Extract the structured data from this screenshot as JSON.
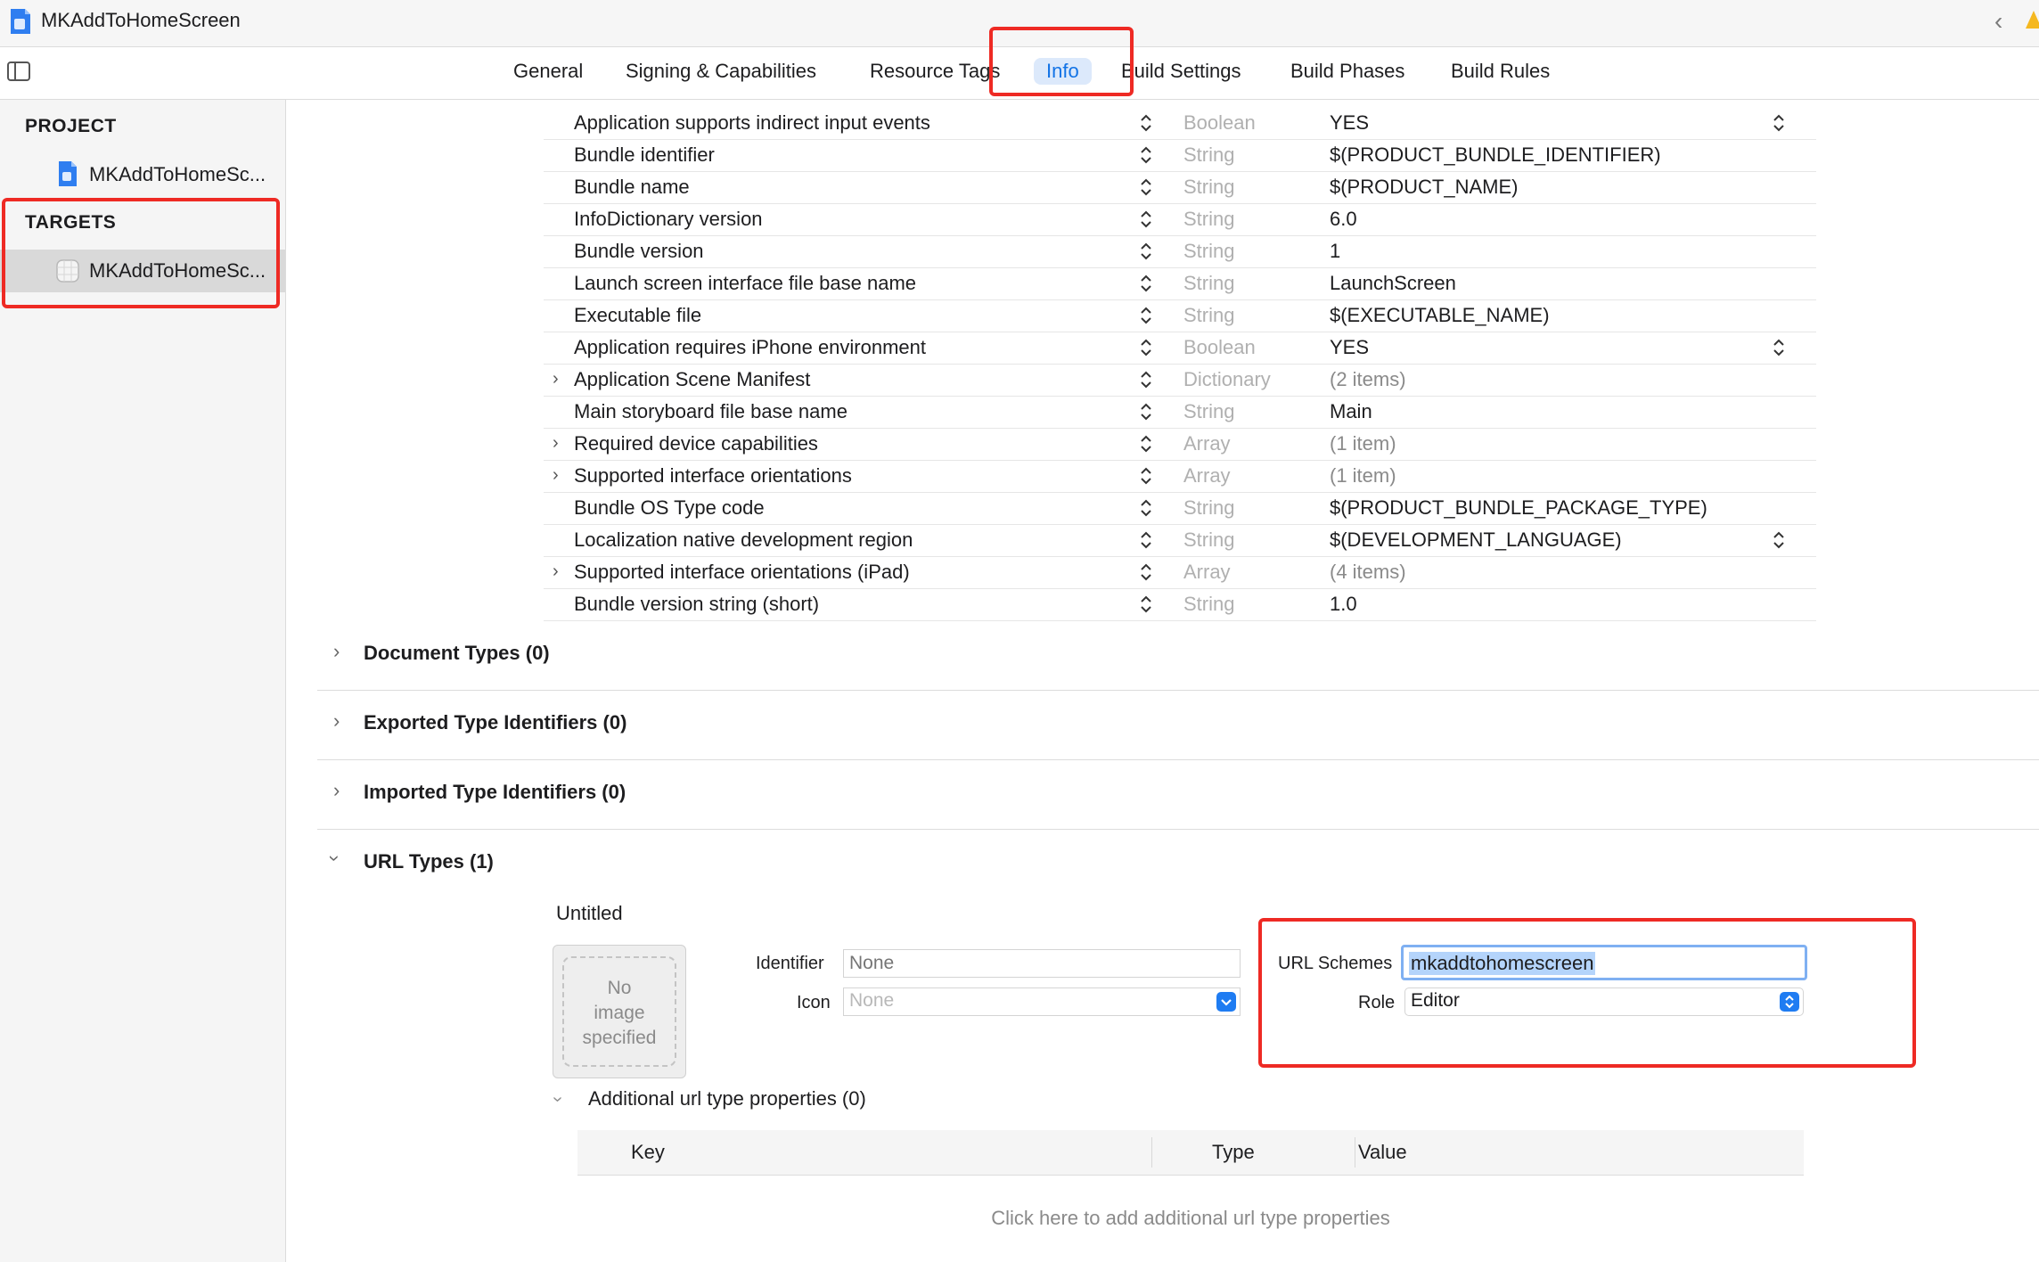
{
  "window": {
    "title": "MKAddToHomeScreen"
  },
  "tabs": [
    {
      "label": "General",
      "active": false
    },
    {
      "label": "Signing & Capabilities",
      "active": false
    },
    {
      "label": "Resource Tags",
      "active": false
    },
    {
      "label": "Info",
      "active": true
    },
    {
      "label": "Build Settings",
      "active": false
    },
    {
      "label": "Build Phases",
      "active": false
    },
    {
      "label": "Build Rules",
      "active": false
    }
  ],
  "sidebar": {
    "project_heading": "PROJECT",
    "project_item": "MKAddToHomeSc...",
    "targets_heading": "TARGETS",
    "target_item": "MKAddToHomeSc..."
  },
  "plist": [
    {
      "key": "Application supports indirect input events",
      "type": "Boolean",
      "value": "YES",
      "expandable": false,
      "popup": true
    },
    {
      "key": "Bundle identifier",
      "type": "String",
      "value": "$(PRODUCT_BUNDLE_IDENTIFIER)",
      "expandable": false,
      "popup": false
    },
    {
      "key": "Bundle name",
      "type": "String",
      "value": "$(PRODUCT_NAME)",
      "expandable": false,
      "popup": false
    },
    {
      "key": "InfoDictionary version",
      "type": "String",
      "value": "6.0",
      "expandable": false,
      "popup": false
    },
    {
      "key": "Bundle version",
      "type": "String",
      "value": "1",
      "expandable": false,
      "popup": false
    },
    {
      "key": "Launch screen interface file base name",
      "type": "String",
      "value": "LaunchScreen",
      "expandable": false,
      "popup": false
    },
    {
      "key": "Executable file",
      "type": "String",
      "value": "$(EXECUTABLE_NAME)",
      "expandable": false,
      "popup": false
    },
    {
      "key": "Application requires iPhone environment",
      "type": "Boolean",
      "value": "YES",
      "expandable": false,
      "popup": true
    },
    {
      "key": "Application Scene Manifest",
      "type": "Dictionary",
      "value": "(2 items)",
      "expandable": true,
      "popup": false
    },
    {
      "key": "Main storyboard file base name",
      "type": "String",
      "value": "Main",
      "expandable": false,
      "popup": false
    },
    {
      "key": "Required device capabilities",
      "type": "Array",
      "value": "(1 item)",
      "expandable": true,
      "popup": false
    },
    {
      "key": "Supported interface orientations",
      "type": "Array",
      "value": "(1 item)",
      "expandable": true,
      "popup": false
    },
    {
      "key": "Bundle OS Type code",
      "type": "String",
      "value": "$(PRODUCT_BUNDLE_PACKAGE_TYPE)",
      "expandable": false,
      "popup": false
    },
    {
      "key": "Localization native development region",
      "type": "String",
      "value": "$(DEVELOPMENT_LANGUAGE)",
      "expandable": false,
      "popup": true
    },
    {
      "key": "Supported interface orientations (iPad)",
      "type": "Array",
      "value": "(4 items)",
      "expandable": true,
      "popup": false
    },
    {
      "key": "Bundle version string (short)",
      "type": "String",
      "value": "1.0",
      "expandable": false,
      "popup": false
    }
  ],
  "sections": {
    "document_types": "Document Types (0)",
    "exported_types": "Exported Type Identifiers (0)",
    "imported_types": "Imported Type Identifiers (0)",
    "url_types": "URL Types (1)"
  },
  "url_type": {
    "name": "Untitled",
    "image_placeholder": [
      "No",
      "image",
      "specified"
    ],
    "identifier_label": "Identifier",
    "identifier_placeholder": "None",
    "icon_label": "Icon",
    "icon_placeholder": "None",
    "url_schemes_label": "URL Schemes",
    "url_schemes_value": "mkaddtohomescreen",
    "role_label": "Role",
    "role_value": "Editor",
    "additional_title": "Additional url type properties (0)",
    "table_headers": {
      "key": "Key",
      "type": "Type",
      "value": "Value"
    },
    "add_hint": "Click here to add additional url type properties"
  },
  "colors": {
    "accent": "#1273e6",
    "highlight_box": "#ee2a24"
  }
}
